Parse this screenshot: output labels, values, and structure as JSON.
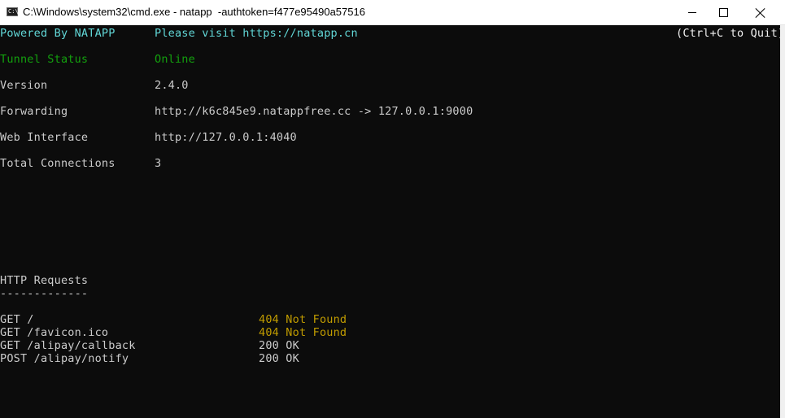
{
  "window": {
    "icon_label": "C:\\",
    "title": "C:\\Windows\\system32\\cmd.exe - natapp  -authtoken=f477e95490a57516"
  },
  "console": {
    "row1": {
      "left": "Powered By NATAPP",
      "right": "Please visit https://natapp.cn",
      "hint": "(Ctrl+C to Quit)"
    },
    "status": [
      {
        "label": "Tunnel Status",
        "value": "Online"
      },
      {
        "label": "Version",
        "value": "2.4.0"
      },
      {
        "label": "Forwarding",
        "value": "http://k6c845e9.natappfree.cc -> 127.0.0.1:9000"
      },
      {
        "label": "Web Interface",
        "value": "http://127.0.0.1:4040"
      },
      {
        "label": "Total Connections",
        "value": "3"
      }
    ],
    "requests_heading": "HTTP Requests",
    "requests_rule": "-------------",
    "requests": [
      {
        "request": "GET /",
        "status": "404 Not Found"
      },
      {
        "request": "GET /favicon.ico",
        "status": "404 Not Found"
      },
      {
        "request": "GET /alipay/callback",
        "status": "200 OK"
      },
      {
        "request": "POST /alipay/notify",
        "status": "200 OK"
      }
    ]
  },
  "colors": {
    "background": "#0c0c0c",
    "cyan": "#61d6d6",
    "green": "#13a10e",
    "yellow": "#c19c00",
    "text": "#cccccc"
  }
}
